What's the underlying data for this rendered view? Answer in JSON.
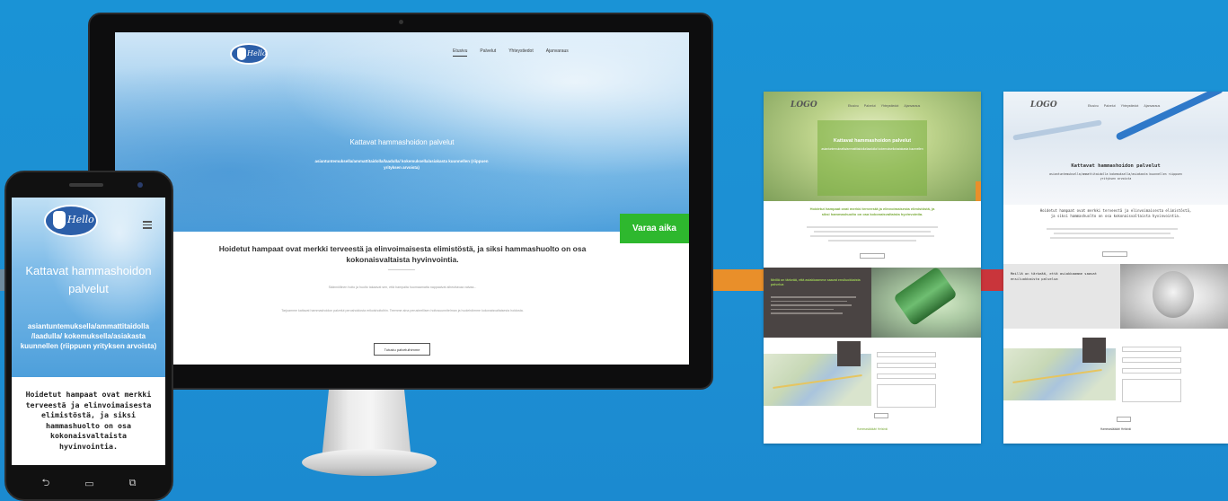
{
  "colors": {
    "background": "#1d8fd3",
    "accent_green": "#2eb82e",
    "brand_blue": "#2c5fa9",
    "stripe_orange": "#e98f2a",
    "stripe_red": "#c9353b"
  },
  "desktop": {
    "logo_text": "Hello",
    "nav": [
      "Etusivu",
      "Palvelut",
      "Yhteystiedot",
      "Ajanvaraus"
    ],
    "hero_title": "Kattavat hammashoidon palvelut",
    "hero_subtitle": "asiantuntemuksella/ammattitaidolla/laadulla/ kokemuksella/asiakasta kuunnellen (riippuen yrityksen arvoista)",
    "cta": "Varaa aika",
    "content_title": "Hoidetut hampaat ovat merkki terveestä ja elinvoimaisesta elimistöstä, ja siksi hammashuolto on osa kokonaisvaltaista hyvinvointia.",
    "content_p1": "Säännöllinen hoito ja huolto takaavat sen, että hampaita huomaamatta nappaaivat aiheuttavaa vaivaa...",
    "content_p2": "Tarjoamme kattavat hammashoidon palvelut perushoidosta erikoishoitoihin. Teemme aina perusteellisen hoitosuunnitelman ja huolehdimme kokonaisvaltaisesta hoidosta.",
    "button": "Tutustu palveluihimme"
  },
  "mobile": {
    "logo_text": "Hello",
    "hero_title": "Kattavat hammashoidon palvelut",
    "hero_subtitle": "asiantuntemuksella/ammattitaidolla /laadulla/ kokemuksella/asiakasta kuunnellen (riippuen yrityksen arvoista)",
    "content": "Hoidetut hampaat ovat merkki terveestä ja elinvoimaisesta elimistöstä, ja siksi hammashuolto on osa kokonaisvaltaista hyvinvointia.",
    "nav_icons": [
      "back-icon",
      "home-icon",
      "recent-apps-icon"
    ]
  },
  "mockup1": {
    "logo": "LOGO",
    "nav": [
      "Etusivu",
      "Palvelut",
      "Yhteystiedot",
      "Ajanvaraus"
    ],
    "hero_title": "Kattavat hammashoidon palvelut",
    "hero_subtitle": "asiantuntemuksella/ammattitaidolla/laadulla/ kokemuksella/asiakasta kuunnellen",
    "green_text": "Hoidetut hampaat ovat merkki terveestä ja elinvoimaisesta elimistöstä, ja siksi hammashuolto on osa kokonaisvaltaista hyvinvointia.",
    "dark_text": "Meillä on tärkeää, että asiakkaamme saavat ensiluokkaista palvelua",
    "footer": "Hammaslääkäri Helsinki"
  },
  "mockup2": {
    "logo": "LOGO",
    "nav": [
      "Etusivu",
      "Palvelut",
      "Yhteystiedot",
      "Ajanvaraus"
    ],
    "hero_title": "Kattavat hammashoidon palvelut",
    "hero_subtitle": "asiantuntemuksella/ammattitaidolla kokemuksella/asiakasta kuunnellen riippuen yrityksen arvoista",
    "intro_text": "Hoidetut hampaat ovat merkki terveestä ja elinvoimaisesta elimistöstä, ja siksi hammashuolto on osa kokonaisvaltaista hyvinvointia.",
    "grey_text": "Meillä on tärkeää, että asiakkaamme saavat ensiluokkaista palvelua",
    "footer": "Hammaslääkäri Helsinki"
  }
}
